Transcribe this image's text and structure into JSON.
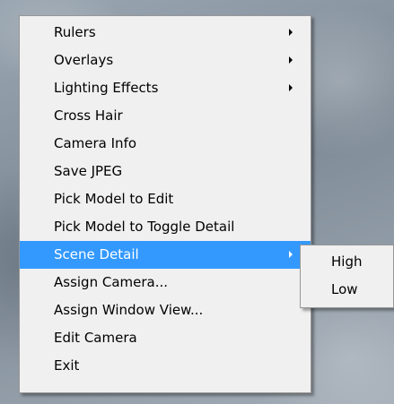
{
  "context_menu": {
    "items": [
      {
        "label": "Rulers",
        "has_submenu": true
      },
      {
        "label": "Overlays",
        "has_submenu": true
      },
      {
        "label": "Lighting Effects",
        "has_submenu": true
      },
      {
        "label": "Cross Hair",
        "has_submenu": false
      },
      {
        "label": "Camera Info",
        "has_submenu": false
      },
      {
        "label": "Save JPEG",
        "has_submenu": false
      },
      {
        "label": "Pick Model to Edit",
        "has_submenu": false
      },
      {
        "label": "Pick Model to Toggle Detail",
        "has_submenu": false
      },
      {
        "label": "Scene Detail",
        "has_submenu": true,
        "highlighted": true
      },
      {
        "label": "Assign Camera...",
        "has_submenu": false
      },
      {
        "label": "Assign Window View...",
        "has_submenu": false
      },
      {
        "label": "Edit Camera",
        "has_submenu": false
      },
      {
        "label": "Exit",
        "has_submenu": false
      }
    ]
  },
  "submenu": {
    "items": [
      {
        "label": "High"
      },
      {
        "label": "Low"
      }
    ]
  },
  "colors": {
    "menu_background": "#f0f0f0",
    "highlight": "#3399ff",
    "highlight_text": "#ffffff",
    "border": "#979797"
  },
  "icons": {
    "submenu_arrow": "submenu-arrow-icon"
  }
}
